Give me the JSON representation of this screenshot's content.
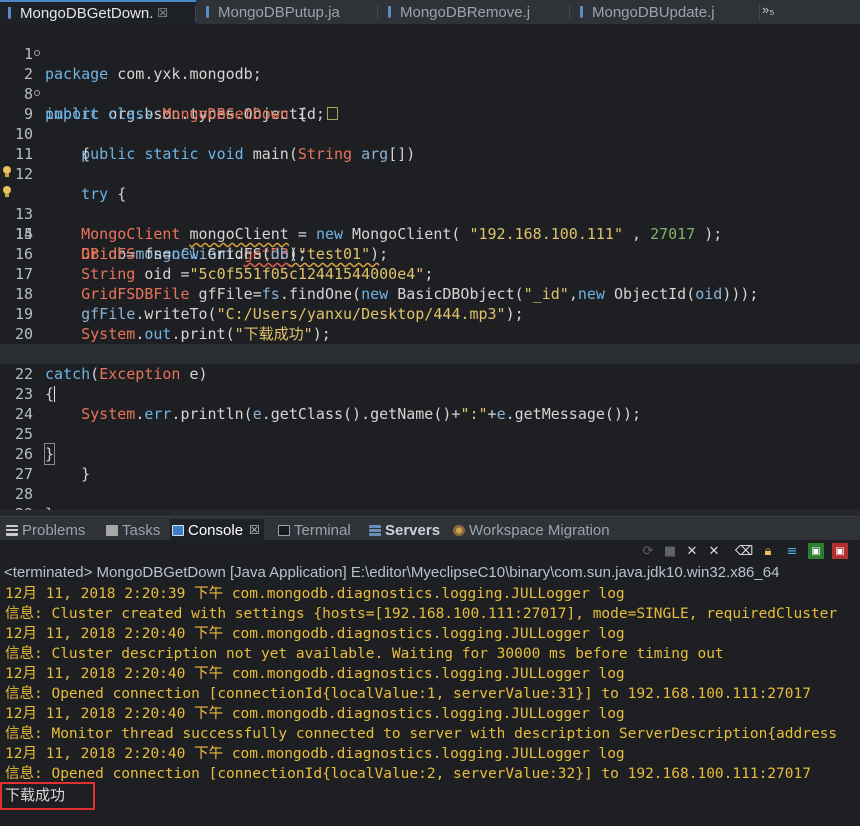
{
  "editor_tabs": [
    {
      "label": "MongoDBGetDown.",
      "close": "☒",
      "active": true
    },
    {
      "label": "MongoDBPutup.ja",
      "active": false
    },
    {
      "label": "MongoDBRemove.j",
      "active": false
    },
    {
      "label": "MongoDBUpdate.j",
      "active": false
    }
  ],
  "tabs_overflow": "»₅",
  "code_lines": [
    {
      "n": "1",
      "text": "package com.yxk.mongodb;"
    },
    {
      "n": "2",
      "text": "import org.bson.types.ObjectId;"
    },
    {
      "n": "8",
      "text": "public class MongoDBGetDown {"
    },
    {
      "n": "9",
      "text": "    public static void main(String arg[])"
    },
    {
      "n": "10",
      "text": "    {"
    },
    {
      "n": "11",
      "text": ""
    },
    {
      "n": "12",
      "text": "    try {"
    },
    {
      "n": "13",
      "text": "    MongoClient mongoClient = new MongoClient( \"192.168.100.111\" , 27017 );"
    },
    {
      "n": "14",
      "text": "    DB db=mongoClient.getDB(\"test01\");"
    },
    {
      "n": "15",
      "text": "    GridFS fs=new GridFS(db);"
    },
    {
      "n": "16",
      "text": "    String oid =\"5c0f551f05c12441544000e4\";"
    },
    {
      "n": "17",
      "text": "    GridFSDBFile gfFile=fs.findOne(new BasicDBObject(\"_id\",new ObjectId(oid)));"
    },
    {
      "n": "18",
      "text": "    gfFile.writeTo(\"C:/Users/yanxu/Desktop/444.mp3\");"
    },
    {
      "n": "19",
      "text": "    System.out.print(\"下载成功\");"
    },
    {
      "n": "20",
      "text": "}"
    },
    {
      "n": "21",
      "text": "catch(Exception e)"
    },
    {
      "n": "22",
      "text": "{"
    },
    {
      "n": "23",
      "text": "    System.err.println(e.getClass().getName()+\":\"+e.getMessage());"
    },
    {
      "n": "24",
      "text": ""
    },
    {
      "n": "25",
      "text": "}"
    },
    {
      "n": "26",
      "text": "    }"
    },
    {
      "n": "27",
      "text": ""
    },
    {
      "n": "28",
      "text": "}"
    },
    {
      "n": "29",
      "text": ""
    }
  ],
  "view_tabs": [
    {
      "label": "Problems",
      "icon": "problems-icon",
      "active": false
    },
    {
      "label": "Tasks",
      "icon": "tasks-icon",
      "active": false
    },
    {
      "label": "Console",
      "icon": "console-icon",
      "active": true,
      "close": "☒"
    },
    {
      "label": "Terminal",
      "icon": "terminal-icon",
      "active": false
    },
    {
      "label": "Servers",
      "icon": "servers-icon",
      "active": false
    },
    {
      "label": "Workspace Migration",
      "icon": "workspace-migration-icon",
      "active": false
    }
  ],
  "console_status": "<terminated> MongoDBGetDown [Java Application] E:\\editor\\MyeclipseC10\\binary\\com.sun.java.jdk10.win32.x86_64",
  "console_lines": [
    "12月 11, 2018 2:20:39 下午 com.mongodb.diagnostics.logging.JULLogger log",
    "信息: Cluster created with settings {hosts=[192.168.100.111:27017], mode=SINGLE, requiredCluster",
    "12月 11, 2018 2:20:40 下午 com.mongodb.diagnostics.logging.JULLogger log",
    "信息: Cluster description not yet available. Waiting for 30000 ms before timing out",
    "12月 11, 2018 2:20:40 下午 com.mongodb.diagnostics.logging.JULLogger log",
    "信息: Opened connection [connectionId{localValue:1, serverValue:31}] to 192.168.100.111:27017",
    "12月 11, 2018 2:20:40 下午 com.mongodb.diagnostics.logging.JULLogger log",
    "信息: Monitor thread successfully connected to server with description ServerDescription{address",
    "12月 11, 2018 2:20:40 下午 com.mongodb.diagnostics.logging.JULLogger log",
    "信息: Opened connection [connectionId{localValue:2, serverValue:32}] to 192.168.100.111:27017"
  ],
  "console_output": "下载成功",
  "colors": {
    "stderr": "#e7bd3c",
    "highlight_box": "#e03030",
    "keyword": "#6fb4e4",
    "type": "#e8735a",
    "string": "#e0c26a"
  }
}
